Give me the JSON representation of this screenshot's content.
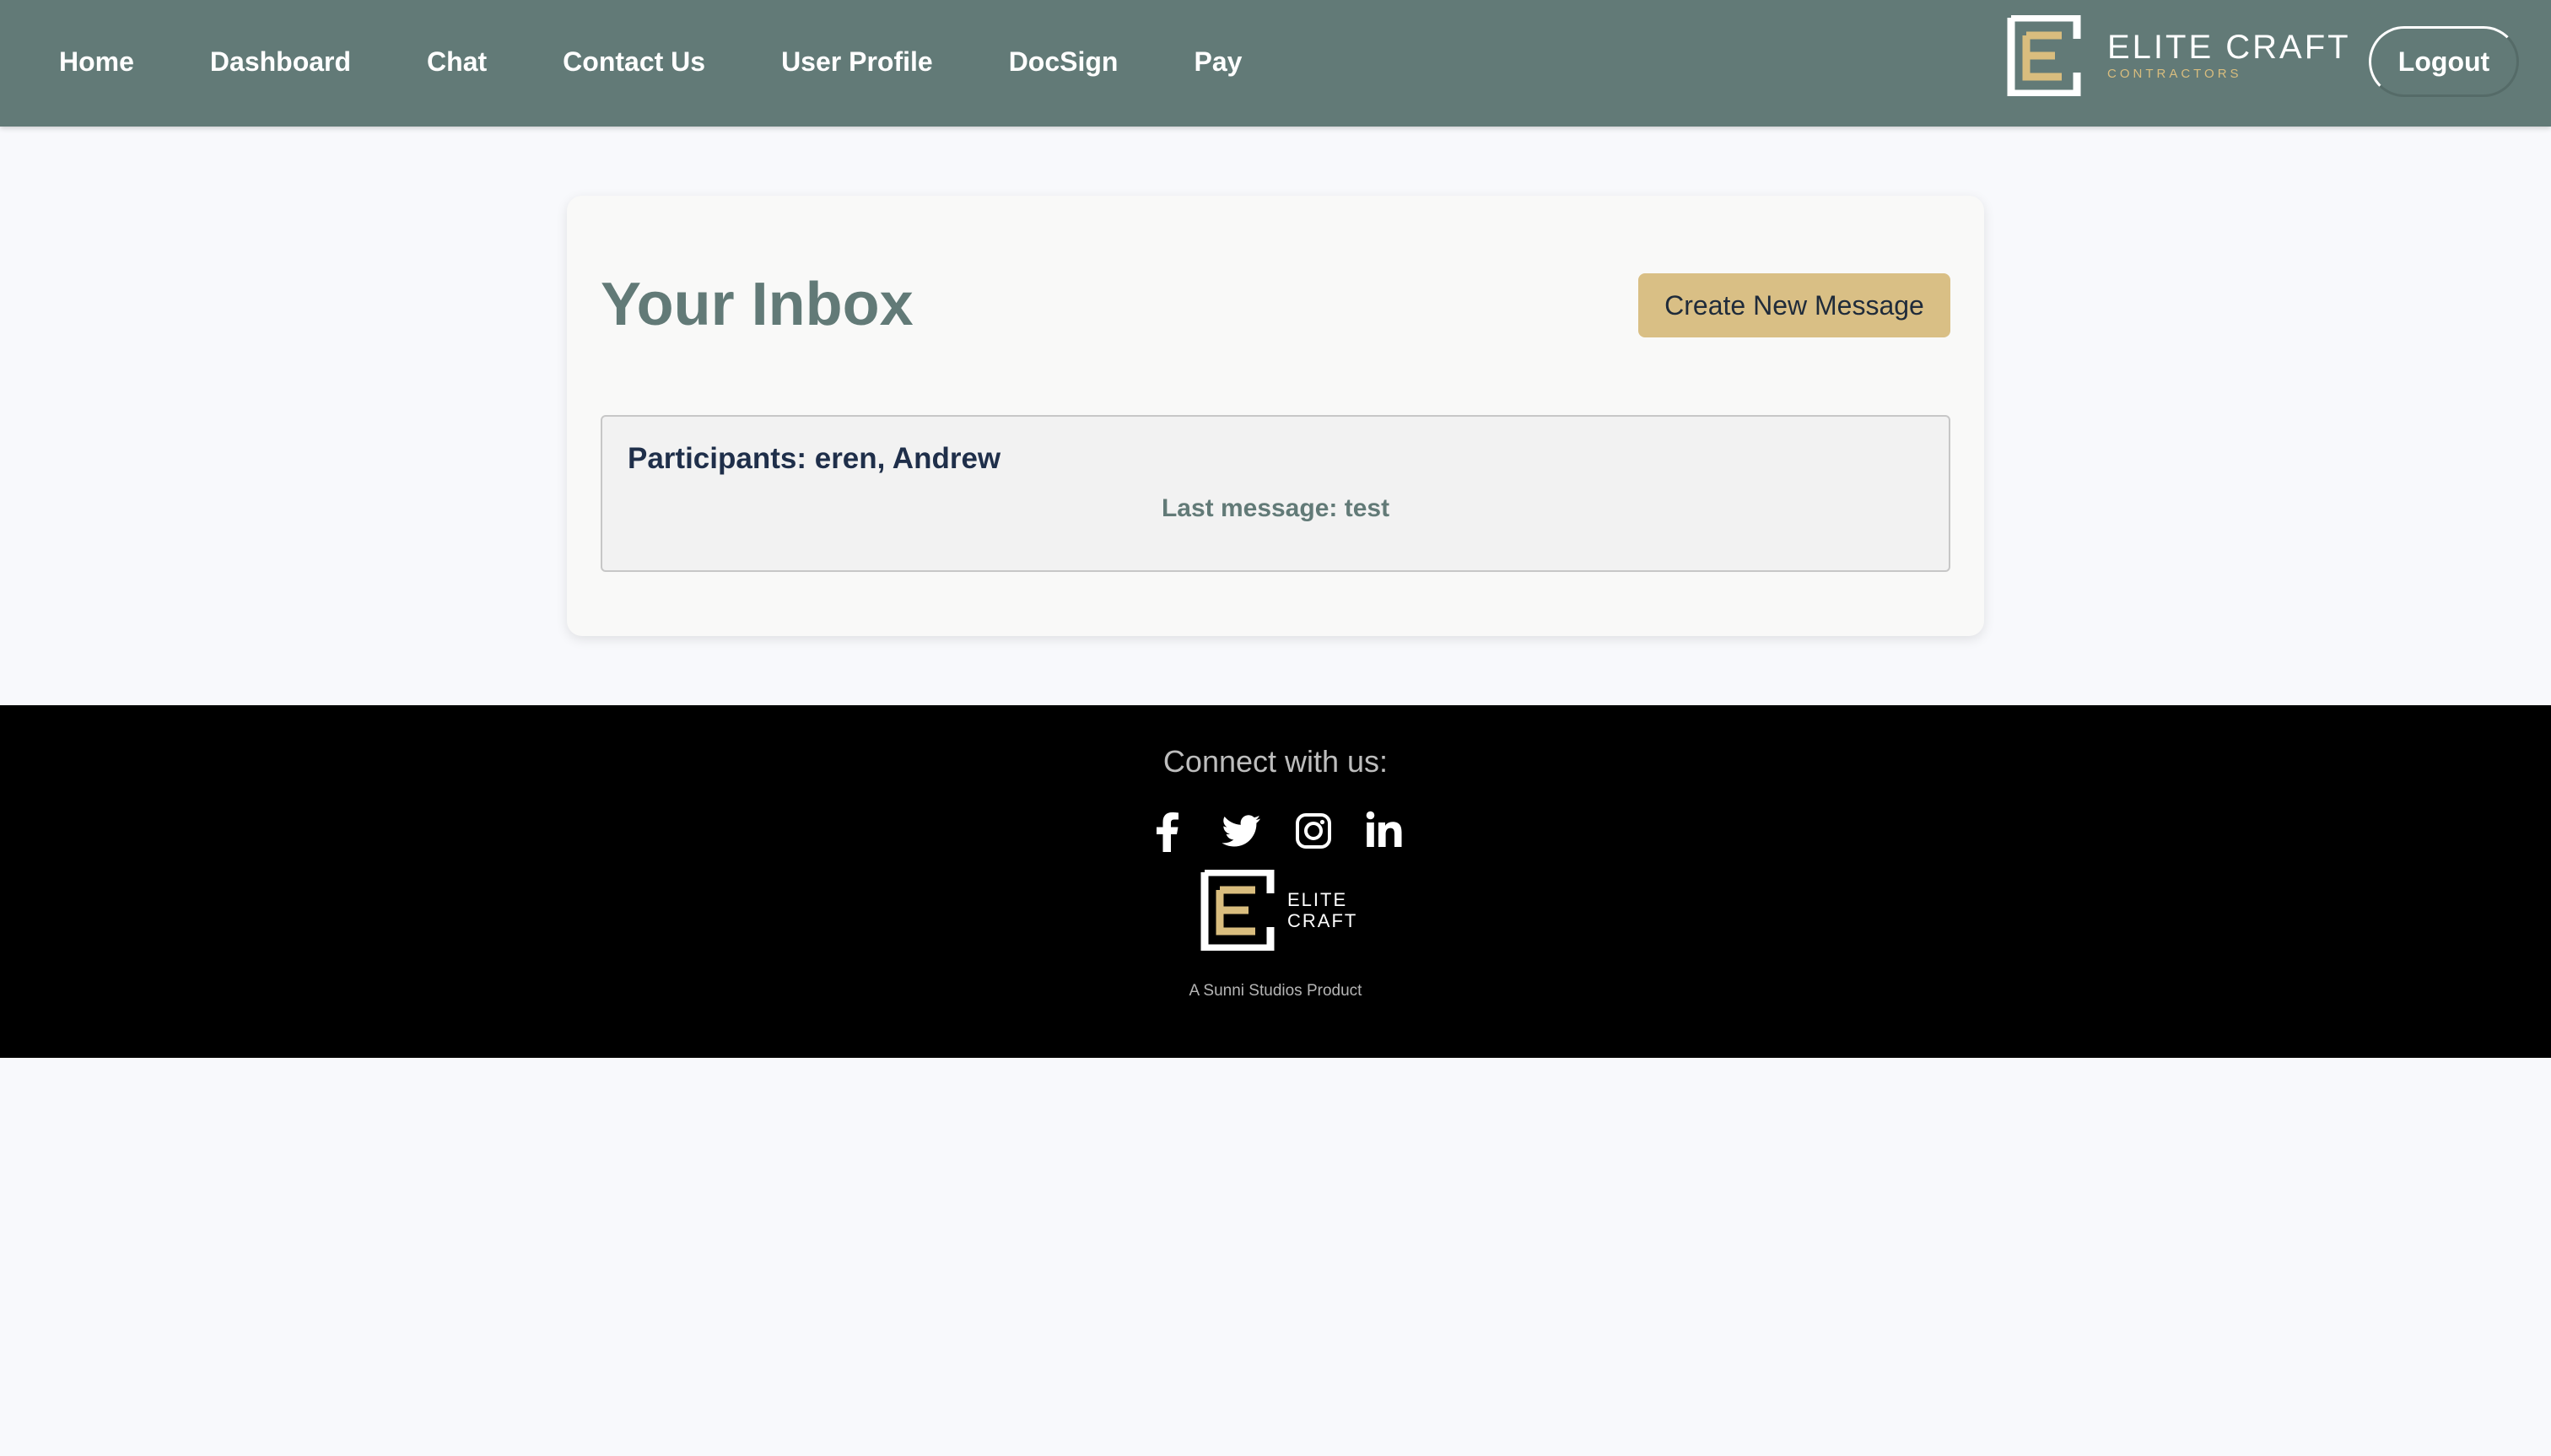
{
  "nav": {
    "links": [
      "Home",
      "Dashboard",
      "Chat",
      "Contact Us",
      "User Profile",
      "DocSign",
      "Pay"
    ],
    "brand_name": "ELITE CRAFT",
    "brand_sub": "CONTRACTORS",
    "logout_label": "Logout"
  },
  "inbox": {
    "title": "Your Inbox",
    "create_label": "Create New Message",
    "conversations": [
      {
        "participants": "Participants: eren, Andrew",
        "last_message": "Last message: test"
      }
    ]
  },
  "footer": {
    "heading": "Connect with us:",
    "socials": [
      "facebook-icon",
      "twitter-icon",
      "instagram-icon",
      "linkedin-icon"
    ],
    "logo_line1": "ELITE",
    "logo_line2": "CRAFT",
    "tagline": "A Sunni Studios Product"
  },
  "colors": {
    "nav_bg": "#627a77",
    "accent_gold": "#d9bf85",
    "title_color": "#627a77",
    "participants_color": "#1f2f4a",
    "footer_bg": "#000000",
    "page_bg": "#f8f9fc"
  }
}
